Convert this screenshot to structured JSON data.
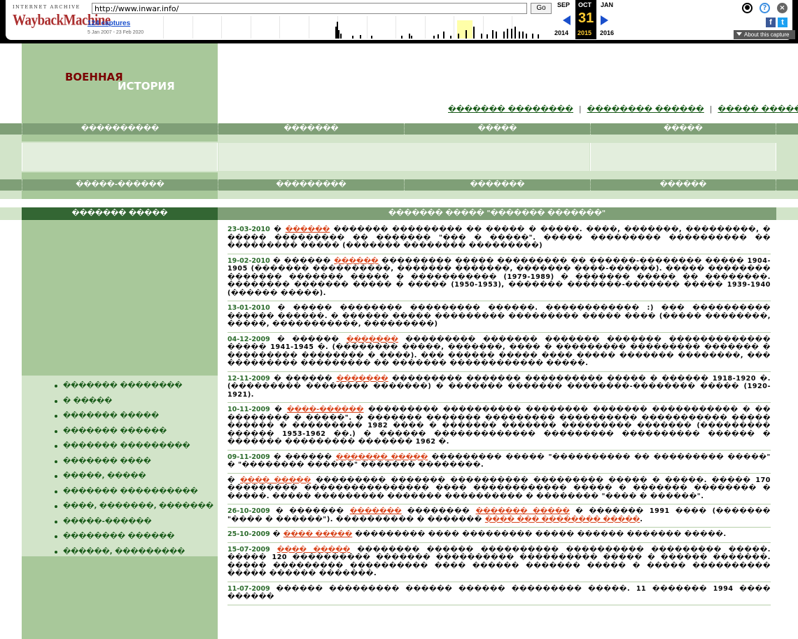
{
  "wayback": {
    "logo_top": "INTERNET ARCHIVE",
    "logo_main": "WaybackMachine",
    "url": "http://www.inwar.info/",
    "go_label": "Go",
    "captures_label": "124 captures",
    "capture_range": "5 Jan 2007 - 23 Feb 2020",
    "months": {
      "prev": "SEP",
      "current": "OCT",
      "next": "JAN"
    },
    "day": "31",
    "years": {
      "prev": "2014",
      "current": "2015",
      "next": "2016"
    },
    "about_label": "About this capture",
    "icons": [
      "user-icon",
      "help-icon",
      "close-icon",
      "facebook-icon",
      "twitter-icon"
    ],
    "sparkline": [
      {
        "pos": 0.455,
        "h": 0.7
      },
      {
        "pos": 0.459,
        "h": 1.0
      },
      {
        "pos": 0.463,
        "h": 0.5
      },
      {
        "pos": 0.468,
        "h": 0.3
      },
      {
        "pos": 0.5,
        "h": 0.15
      },
      {
        "pos": 0.52,
        "h": 0.2
      },
      {
        "pos": 0.55,
        "h": 0.15
      },
      {
        "pos": 0.63,
        "h": 0.15
      },
      {
        "pos": 0.65,
        "h": 0.3
      },
      {
        "pos": 0.655,
        "h": 0.15
      },
      {
        "pos": 0.715,
        "h": 0.15
      },
      {
        "pos": 0.725,
        "h": 0.25
      },
      {
        "pos": 0.74,
        "h": 0.4
      },
      {
        "pos": 0.76,
        "h": 0.15
      },
      {
        "pos": 0.78,
        "h": 0.3
      },
      {
        "pos": 0.8,
        "h": 0.5
      },
      {
        "pos": 0.82,
        "h": 0.7
      },
      {
        "pos": 0.84,
        "h": 0.3
      },
      {
        "pos": 0.855,
        "h": 0.25
      },
      {
        "pos": 0.87,
        "h": 0.5
      },
      {
        "pos": 0.88,
        "h": 0.4
      },
      {
        "pos": 0.9,
        "h": 0.4
      },
      {
        "pos": 0.91,
        "h": 0.6
      },
      {
        "pos": 0.92,
        "h": 0.6
      },
      {
        "pos": 0.93,
        "h": 0.7
      },
      {
        "pos": 0.94,
        "h": 0.4
      },
      {
        "pos": 0.95,
        "h": 0.4
      },
      {
        "pos": 0.96,
        "h": 0.3
      },
      {
        "pos": 0.975,
        "h": 0.3
      },
      {
        "pos": 0.99,
        "h": 0.25
      }
    ]
  },
  "site": {
    "logo_part1": "ВОЕННАЯ",
    "logo_part2": "ИСТОРИЯ",
    "top_links": [
      "������� ��������",
      "�������� ������",
      "����� �����"
    ],
    "menu1": [
      "����������",
      "�������",
      "�����",
      "�����"
    ],
    "menu2": [
      "�����-������",
      "���������",
      "�������",
      "������"
    ],
    "section_left": "������� �����",
    "section_right": "������� ����� \"������� �������\"",
    "left_menu": [
      "������� ��������",
      "� �����",
      "������� �����",
      "������� ������",
      "������� ���������",
      "������� ����",
      "�����, �����",
      "������� ����������",
      "����, �������, �������",
      "�����-������",
      "�������� ������",
      "������, ���������"
    ],
    "news": [
      {
        "date": "23-03-2010",
        "pre": " � ",
        "link": "������",
        "text": " ������� ��������� �� ����� � �����. ����, �������, ���������, � ����� ��������� �� ������� \"��� � �����\". ����� ��������� ���������� �� ��������� ����� (������� �������� ���������)"
      },
      {
        "date": "19-02-2010",
        "pre": " � ������ ",
        "link": "������",
        "text": " ��������� ����� ��������� �� ������-�������� ����� 1904-1905 (������� ����������, ������� �������, ������� ����-������). ����� �������� ������� ������� ����� � ����������� (1979-1989) � ������� ����� �� ��������. �������� ������� ����� � ����� (1950-1953), ������� �������-������� ����� 1939-1940 (������ �����)."
      },
      {
        "date": "13-01-2010",
        "pre": " � ����� ",
        "link": "",
        "text": "�������� ��������� ������. ������������ :) ��� ���������� ������ ������. � ������ ����� ��������� ��������� ����� ���� (����� ��������, �����, �����������, ���������)"
      },
      {
        "date": "04-12-2009",
        "pre": " � ������ ",
        "link": "�������",
        "text": " ��������� ������� ������� ������� ������������� ����� 1941-1945 �. (�������� �����, �������, ���� � ��������� ��������� ������� � ��������� �������� � ����). ��� ������ ����� ���� ����� ������� ��������, ��� ��������� ��������� �� ������� ������������ �����."
      },
      {
        "date": "12-11-2009",
        "pre": " � ������ ",
        "link": "�������",
        "text": " ��������� ������� ���������� ����� � ������ 1918-1920 �. (��������� �������� �������) � ������� ������� ��������-�������� ����� (1920-1921)."
      },
      {
        "date": "10-11-2009",
        "pre": " � ",
        "link": "����-������",
        "text": " ��������� ���������� �������� ������� ����������� � �� �������� � �����\". � ������� ������� ��������� ���������� ����������� ����� ������ � ��������� 1982 ���� � ������� ������� ��������� ������� (��������� ������ 1953-1962 ��.) � ������ ������������� ��������� ���������� ������ � ������� ��������� ������� 1962 �."
      },
      {
        "date": "09-11-2009",
        "pre": " � ������ ",
        "link": "������� �����",
        "text": " ��������� ����� \"���������� �� ��������� �����\" � \"�������� ������\" ������� ��������."
      },
      {
        "date": "",
        "pre": "� ",
        "link": "���� �����",
        "text": " ��������� ������� ���������� ��������� ����� � �����. ����� 170 ��������� ���������������� ���� ������������ ����� � ������� �������� � �����. ����� ��������� ������� ���������� � �������� \"���� � ������\"."
      },
      {
        "date": "26-10-2009",
        "pre": " � ������� ",
        "link": "�������",
        "text": " �������� ",
        "link2": "������� �����",
        "text2": " � ������� 1991 ���� (������� \"���� � ������\"). ���������� � ������� ",
        "link3": "���� ��� �������� �����",
        "text3": "."
      },
      {
        "date": "25-10-2009",
        "pre": " � ",
        "link": "���� �����",
        "text": " ��������� ���� ��������� ����� ������ ������� �����."
      },
      {
        "date": "15-07-2009",
        "pre": " ",
        "link": "���� �����",
        "text": " �������� ������ ���������� ���������� ��������� �����. ����� 120 ���������� ������� ���������� ���������� ����� � ������ �������. ����� ��������� ���������� ���� ������ ������� ����� � ����� ���������� ����� ������ �������."
      },
      {
        "date": "11-07-2009",
        "pre": " ",
        "link": "",
        "text": "������ ��������� ������ ������ ��������� �����. 11 ������� 1994 ���� ������"
      }
    ]
  }
}
